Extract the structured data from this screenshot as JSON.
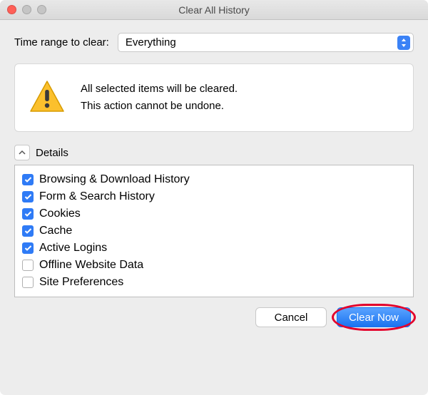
{
  "titlebar": {
    "title": "Clear All History"
  },
  "range": {
    "label": "Time range to clear:",
    "value": "Everything"
  },
  "warning": {
    "line1": "All selected items will be cleared.",
    "line2": "This action cannot be undone."
  },
  "details": {
    "label": "Details",
    "items": [
      {
        "label": "Browsing & Download History",
        "checked": true
      },
      {
        "label": "Form & Search History",
        "checked": true
      },
      {
        "label": "Cookies",
        "checked": true
      },
      {
        "label": "Cache",
        "checked": true
      },
      {
        "label": "Active Logins",
        "checked": true
      },
      {
        "label": "Offline Website Data",
        "checked": false
      },
      {
        "label": "Site Preferences",
        "checked": false
      }
    ]
  },
  "buttons": {
    "cancel": "Cancel",
    "clear": "Clear Now"
  }
}
